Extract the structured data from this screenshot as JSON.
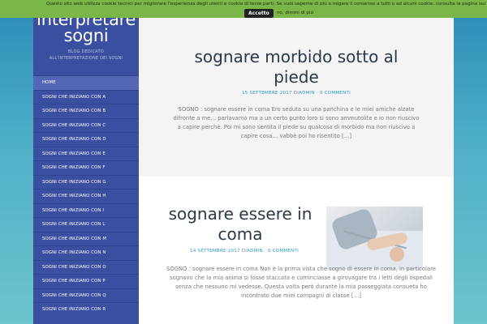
{
  "cookie": {
    "message": "Questo sito web utilizza cookie tecnici per migliorare l'esperienza degli utenti e cookie di terze parti. Se vuoi saperne di più o negare il consenso a tutti o ad alcuni cookie, consulta la pagina sui cookie",
    "accept_label": "Accetto",
    "more_label": "no, dimmi di più"
  },
  "site": {
    "title": "Interpretare sogni",
    "description": "BLOG DEDICATO ALL'INTERPRETAZIONE DEI SOGNI"
  },
  "nav": {
    "items": [
      "HOME",
      "SOGNI CHE INIZIANO CON A",
      "SOGNI CHE INIZIANO CON B",
      "SOGNI CHE INIZIANO CON C",
      "SOGNI CHE INIZIANO CON D",
      "SOGNI CHE INIZIANO CON E",
      "SOGNI CHE INIZIANO CON F",
      "SOGNI CHE INIZIANO CON G",
      "SOGNI CHE INIZIANO CON H",
      "SOGNI CHE INIZIANO CON I",
      "SOGNI CHE INIZIANO CON L",
      "SOGNI CHE INIZIANO CON M",
      "SOGNI CHE INIZIANO CON N",
      "SOGNI CHE INIZIANO CON O",
      "SOGNI CHE INIZIANO CON P",
      "SOGNI CHE INIZIANO CON Q",
      "SOGNI CHE INIZIANO CON R"
    ]
  },
  "posts": [
    {
      "title": "sognare morbido sotto al piede",
      "date": "15 SETTEMBRE 2017",
      "by": "DI",
      "author": "ADMIN",
      "comments": "0 COMMENTI",
      "excerpt": "SOGNO : sognare essere in coma Ero seduta su una panchina e le miei amiche alzate difronte a me… parlavamo ma a un certo punto loro si sono ammutolite e io non riuscivo a capire perchè. Poi mi sono sentita il piede su qualcosa di morbido ma non riuscivo a capire cosa… vabbè poi ho risentito […]"
    },
    {
      "title": "sognare essere in coma",
      "date": "14 SETTEMBRE 2017",
      "by": "DI",
      "author": "ADMIN",
      "comments": "0 COMMENTI",
      "image": "hospital-patient-thumbnail",
      "excerpt": "SOGNO : sognare essere in coma Non è la prima vista che sogno di essere in coma, in particolare sognavo che la mia anima si fosse staccata e cominciasse a girovagare tra i letti degli ospedali senza che nessuno mi vedesse. Questa volta però durante la mia passeggiata consueta ho incontrato due miei compagni di classe […]"
    }
  ]
}
